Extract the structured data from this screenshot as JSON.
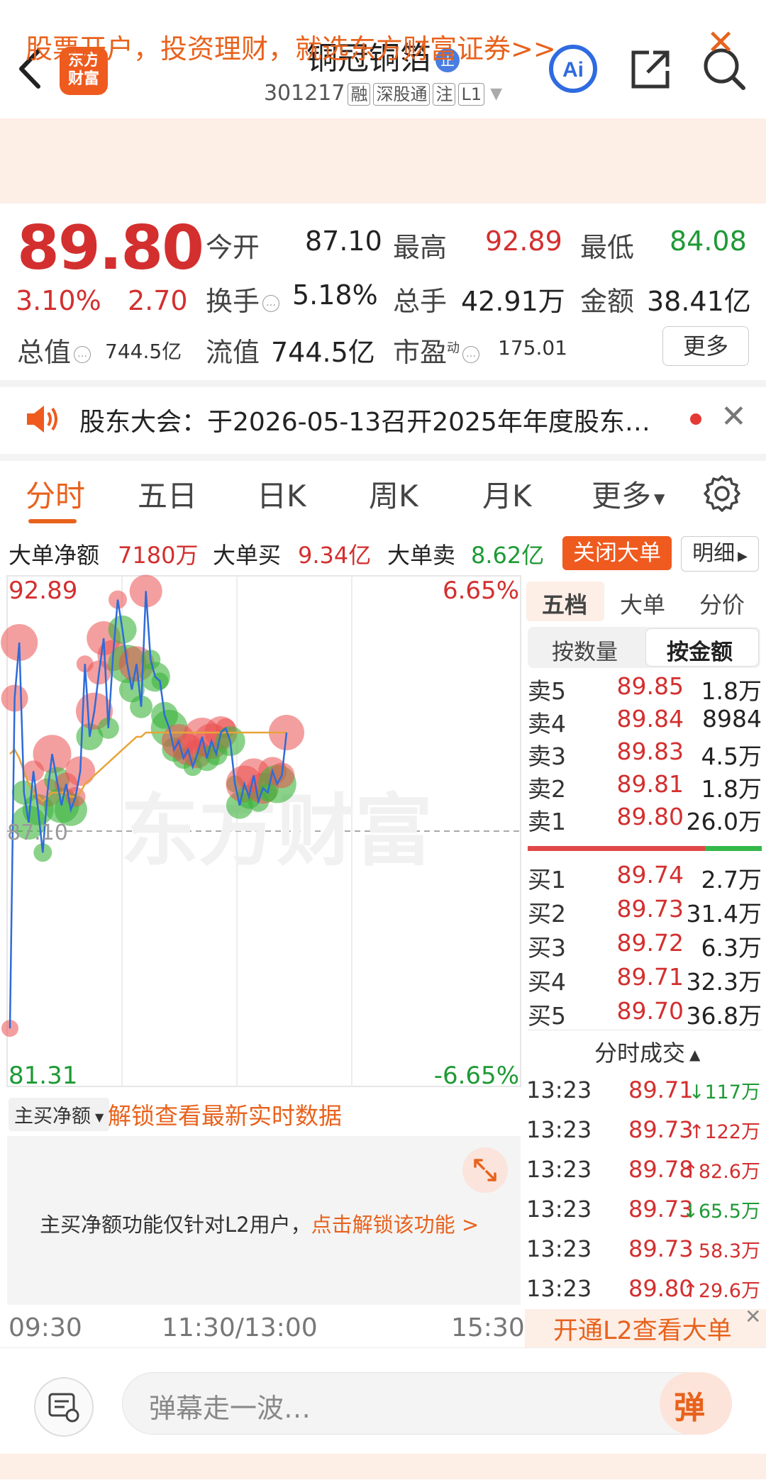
{
  "header": {
    "title": "铜冠铜箔",
    "title_badge": "正",
    "code": "301217",
    "tags": [
      "融",
      "深股通",
      "注",
      "L1"
    ],
    "logo_line1": "东方",
    "logo_line2": "财富",
    "ai_label": "Ai"
  },
  "banner": {
    "text": "股票开户，投资理财，就选东方财富证券>>",
    "close": "✕"
  },
  "quote": {
    "price": "89.80",
    "change_pct": "3.10%",
    "change": "2.70",
    "open_label": "今开",
    "open": "87.10",
    "high_label": "最高",
    "high": "92.89",
    "low_label": "最低",
    "low": "84.08",
    "turnover_label": "换手",
    "turnover": "5.18%",
    "volume_label": "总手",
    "volume": "42.91万",
    "amount_label": "金额",
    "amount": "38.41亿",
    "mktcap_label": "总值",
    "mktcap": "744.5亿",
    "float_label": "流值",
    "float": "744.5亿",
    "pe_label": "市盈",
    "pe_sup": "动",
    "pe": "175.01",
    "more": "更多"
  },
  "notice": {
    "text": "股东大会：于2026-05-13召开2025年年度股东…",
    "close": "✕"
  },
  "tabs": [
    "分时",
    "五日",
    "日K",
    "周K",
    "月K",
    "更多"
  ],
  "big_order": {
    "net_label": "大单净额",
    "net": "7180万",
    "buy_label": "大单买",
    "buy": "9.34亿",
    "sell_label": "大单卖",
    "sell": "8.62亿",
    "close_btn": "关闭大单",
    "detail_btn": "明细"
  },
  "chart": {
    "y_top": "92.89",
    "y_bottom": "81.31",
    "pct_top": "6.65%",
    "pct_bottom": "-6.65%",
    "mid_label": "87.10",
    "watermark": "东方财富",
    "time_start": "09:30",
    "time_mid": "11:30/13:00",
    "time_end": "15:30"
  },
  "chart_data": {
    "type": "line",
    "title": "",
    "xlabel": "",
    "ylabel": "",
    "ylim": [
      81.31,
      92.89
    ],
    "ref_price": 87.1,
    "price_series": [
      82.5,
      90.2,
      91.5,
      88.0,
      87.3,
      88.5,
      87.6,
      86.6,
      88.0,
      88.9,
      88.3,
      87.7,
      88.2,
      87.6,
      87.9,
      88.5,
      91.0,
      89.3,
      89.9,
      90.8,
      91.6,
      89.5,
      91.2,
      92.5,
      91.8,
      91.0,
      90.4,
      91.0,
      90.0,
      92.7,
      91.1,
      90.7,
      90.6,
      89.8,
      89.5,
      89.0,
      89.2,
      88.8,
      89.0,
      88.6,
      88.9,
      89.3,
      88.8,
      89.2,
      88.9,
      89.4,
      89.5,
      89.2,
      88.2,
      87.7,
      88.2,
      87.9,
      88.4,
      87.8,
      88.1,
      88.0,
      88.5,
      88.2,
      88.4,
      89.4
    ],
    "avg_series": [
      88.9,
      89.0,
      88.8,
      88.5,
      88.2,
      88.0,
      87.9,
      87.8,
      87.9,
      88.0,
      88.0,
      88.0,
      88.0,
      87.9,
      87.9,
      88.0,
      88.2,
      88.3,
      88.4,
      88.5,
      88.6,
      88.7,
      88.8,
      88.9,
      89.0,
      89.1,
      89.2,
      89.3,
      89.3,
      89.4,
      89.4,
      89.4,
      89.4,
      89.4,
      89.4,
      89.4,
      89.4,
      89.4,
      89.4,
      89.4,
      89.4,
      89.4,
      89.4,
      89.4,
      89.4,
      89.4,
      89.4,
      89.4,
      89.4,
      89.4,
      89.4,
      89.4,
      89.4,
      89.4,
      89.4,
      89.4,
      89.4,
      89.4,
      89.4,
      89.4
    ]
  },
  "order_book": {
    "tabs": [
      "五档",
      "大单",
      "分价"
    ],
    "seg": [
      "按数量",
      "按金额"
    ],
    "asks": [
      {
        "label": "卖5",
        "price": "89.85",
        "vol": "1.8万"
      },
      {
        "label": "卖4",
        "price": "89.84",
        "vol": "8984"
      },
      {
        "label": "卖3",
        "price": "89.83",
        "vol": "4.5万"
      },
      {
        "label": "卖2",
        "price": "89.81",
        "vol": "1.8万"
      },
      {
        "label": "卖1",
        "price": "89.80",
        "vol": "26.0万"
      }
    ],
    "bids": [
      {
        "label": "买1",
        "price": "89.74",
        "vol": "2.7万"
      },
      {
        "label": "买2",
        "price": "89.73",
        "vol": "31.4万"
      },
      {
        "label": "买3",
        "price": "89.72",
        "vol": "6.3万"
      },
      {
        "label": "买4",
        "price": "89.71",
        "vol": "32.3万"
      },
      {
        "label": "买5",
        "price": "89.70",
        "vol": "36.8万"
      }
    ],
    "ticks_title": "分时成交",
    "ticks": [
      {
        "time": "13:23",
        "price": "89.71",
        "dir": "↓",
        "vol": "117万",
        "color": "#1e9a35"
      },
      {
        "time": "13:23",
        "price": "89.73",
        "dir": "↑",
        "vol": "122万",
        "color": "#d32f2f"
      },
      {
        "time": "13:23",
        "price": "89.78",
        "dir": "↑",
        "vol": "82.6万",
        "color": "#d32f2f"
      },
      {
        "time": "13:23",
        "price": "89.73",
        "dir": "↓",
        "vol": "65.5万",
        "color": "#1e9a35"
      },
      {
        "time": "13:23",
        "price": "89.73",
        "dir": "",
        "vol": "58.3万",
        "color": "#d32f2f"
      },
      {
        "time": "13:23",
        "price": "89.80",
        "dir": "↑",
        "vol": "29.6万",
        "color": "#d32f2f"
      }
    ],
    "l2_text": "开通L2查看大单"
  },
  "money_flow": {
    "select": "主买净额",
    "link": "解锁查看最新实时数据",
    "msg_plain": "主买净额功能仅针对L2用户，",
    "msg_link": "点击解锁该功能 >"
  },
  "danmu": {
    "placeholder": "弹幕走一波…",
    "send": "弹"
  },
  "colors": {
    "up": "#d32f2f",
    "down": "#1e9a35",
    "accent": "#e8621c"
  }
}
